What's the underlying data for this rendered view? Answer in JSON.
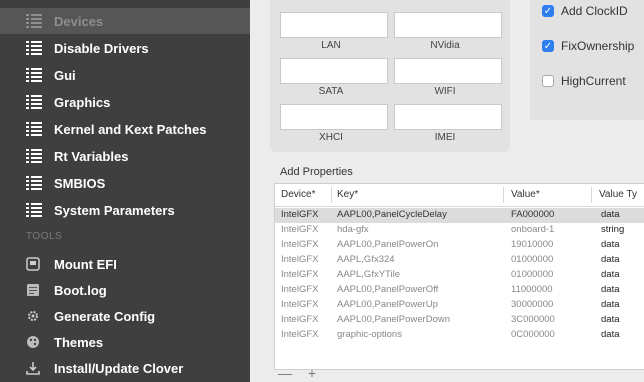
{
  "sidebar": {
    "items": [
      {
        "label": "Devices",
        "icon": "list-icon"
      },
      {
        "label": "Disable Drivers",
        "icon": "list-icon"
      },
      {
        "label": "Gui",
        "icon": "list-icon"
      },
      {
        "label": "Graphics",
        "icon": "list-icon"
      },
      {
        "label": "Kernel and Kext Patches",
        "icon": "list-icon"
      },
      {
        "label": "Rt Variables",
        "icon": "list-icon"
      },
      {
        "label": "SMBIOS",
        "icon": "list-icon"
      },
      {
        "label": "System Parameters",
        "icon": "list-icon"
      }
    ],
    "tools_header": "TOOLS",
    "tools": [
      {
        "label": "Mount EFI",
        "icon": "disk-icon"
      },
      {
        "label": "Boot.log",
        "icon": "document-icon"
      },
      {
        "label": "Generate Config",
        "icon": "gear-icon"
      },
      {
        "label": "Themes",
        "icon": "palette-icon"
      },
      {
        "label": "Install/Update Clover",
        "icon": "download-icon"
      }
    ]
  },
  "fields": [
    {
      "label": "LAN",
      "value": ""
    },
    {
      "label": "NVidia",
      "value": ""
    },
    {
      "label": "SATA",
      "value": ""
    },
    {
      "label": "WIFI",
      "value": ""
    },
    {
      "label": "XHCI",
      "value": ""
    },
    {
      "label": "IMEI",
      "value": ""
    }
  ],
  "checkboxes": [
    {
      "label": "Add ClockID",
      "checked": true
    },
    {
      "label": "FixOwnership",
      "checked": true
    },
    {
      "label": "HighCurrent",
      "checked": false
    }
  ],
  "add_properties": {
    "title": "Add Properties",
    "columns": [
      "Device*",
      "Key*",
      "Value*",
      "Value Ty"
    ],
    "rows": [
      {
        "device": "IntelGFX",
        "key": "AAPL00,PanelCycleDelay",
        "value": "FA000000",
        "type": "data"
      },
      {
        "device": "IntelGFX",
        "key": "hda-gfx",
        "value": "onboard-1",
        "type": "string"
      },
      {
        "device": "IntelGFX",
        "key": "AAPL00,PanelPowerOn",
        "value": "19010000",
        "type": "data"
      },
      {
        "device": "IntelGFX",
        "key": "AAPL,Gfx324",
        "value": "01000000",
        "type": "data"
      },
      {
        "device": "IntelGFX",
        "key": "AAPL,GfxYTile",
        "value": "01000000",
        "type": "data"
      },
      {
        "device": "IntelGFX",
        "key": "AAPL00,PanelPowerOff",
        "value": "11000000",
        "type": "data"
      },
      {
        "device": "IntelGFX",
        "key": "AAPL00,PanelPowerUp",
        "value": "30000000",
        "type": "data"
      },
      {
        "device": "IntelGFX",
        "key": "AAPL00,PanelPowerDown",
        "value": "3C000000",
        "type": "data"
      },
      {
        "device": "IntelGFX",
        "key": "graphic-options",
        "value": "0C000000",
        "type": "data"
      }
    ],
    "footer": "— +"
  }
}
